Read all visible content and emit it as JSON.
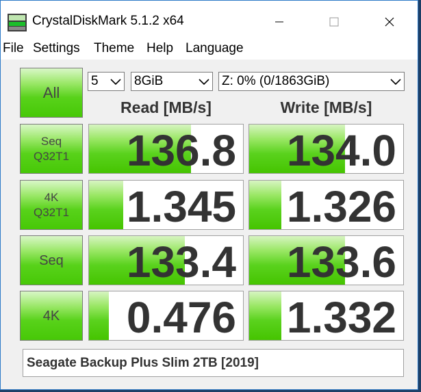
{
  "window": {
    "title": "CrystalDiskMark 5.1.2 x64",
    "icon": "crystaldiskmark-app-icon"
  },
  "menu": {
    "items": [
      "File",
      "Settings",
      "Theme",
      "Help",
      "Language"
    ]
  },
  "controls": {
    "all_label": "All",
    "count_value": "5",
    "size_value": "8GiB",
    "drive_value": "Z: 0% (0/1863GiB)"
  },
  "headers": {
    "read": "Read [MB/s]",
    "write": "Write [MB/s]"
  },
  "tests": [
    {
      "line1": "Seq",
      "line2": "Q32T1",
      "read": "136.8",
      "write": "134.0",
      "read_fill": 0.66,
      "write_fill": 0.62
    },
    {
      "line1": "4K",
      "line2": "Q32T1",
      "read": "1.345",
      "write": "1.326",
      "read_fill": 0.22,
      "write_fill": 0.21
    },
    {
      "line1": "Seq",
      "line2": "",
      "read": "133.4",
      "write": "133.6",
      "read_fill": 0.62,
      "write_fill": 0.62
    },
    {
      "line1": "4K",
      "line2": "",
      "read": "0.476",
      "write": "1.332",
      "read_fill": 0.13,
      "write_fill": 0.21
    }
  ],
  "comment": "Seagate Backup Plus Slim 2TB [2019]",
  "colors": {
    "bar_green": "#58d21a",
    "window_border": "#2b79c7",
    "desktop": "#1e3f66"
  }
}
